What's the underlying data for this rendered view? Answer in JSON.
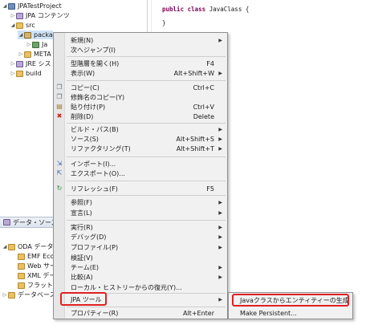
{
  "editor": {
    "line1_keywords": "public class",
    "line1_name": "JavaClass {",
    "line2": "}"
  },
  "tree": {
    "project": "JPATestProject",
    "jpa_content": "JPA コンテンツ",
    "src": "src",
    "package": "packa",
    "java_file": "Ja",
    "meta": "META",
    "jre": "JRE シス",
    "build": "build"
  },
  "data_source_panel": {
    "tab_label": "データ・ソース・",
    "items": [
      "ODA データ",
      "EMF Eco",
      "Web サー",
      "XML デー",
      "フラット",
      "データベース"
    ]
  },
  "context_menu": {
    "items": [
      {
        "label": "新規(N)",
        "shortcut": "",
        "submenu": true
      },
      {
        "label": "次へジャンプ(I)",
        "shortcut": "",
        "submenu": false
      },
      {
        "label": "型階層を開く(H)",
        "shortcut": "F4",
        "submenu": false
      },
      {
        "label": "表示(W)",
        "shortcut": "Alt+Shift+W",
        "submenu": true
      },
      {
        "label": "コピー(C)",
        "shortcut": "Ctrl+C",
        "submenu": false
      },
      {
        "label": "修飾名のコピー(Y)",
        "shortcut": "",
        "submenu": false
      },
      {
        "label": "貼り付け(P)",
        "shortcut": "Ctrl+V",
        "submenu": false
      },
      {
        "label": "削除(D)",
        "shortcut": "Delete",
        "submenu": false
      },
      {
        "label": "ビルド・パス(B)",
        "shortcut": "",
        "submenu": true
      },
      {
        "label": "ソース(S)",
        "shortcut": "Alt+Shift+S",
        "submenu": true
      },
      {
        "label": "リファクタリング(T)",
        "shortcut": "Alt+Shift+T",
        "submenu": true
      },
      {
        "label": "インポート(I)...",
        "shortcut": "",
        "submenu": false
      },
      {
        "label": "エクスポート(O)...",
        "shortcut": "",
        "submenu": false
      },
      {
        "label": "リフレッシュ(F)",
        "shortcut": "F5",
        "submenu": false
      },
      {
        "label": "参照(F)",
        "shortcut": "",
        "submenu": true
      },
      {
        "label": "宣言(L)",
        "shortcut": "",
        "submenu": true
      },
      {
        "label": "実行(R)",
        "shortcut": "",
        "submenu": true
      },
      {
        "label": "デバッグ(D)",
        "shortcut": "",
        "submenu": true
      },
      {
        "label": "プロファイル(P)",
        "shortcut": "",
        "submenu": true
      },
      {
        "label": "検証(V)",
        "shortcut": "",
        "submenu": false
      },
      {
        "label": "チーム(E)",
        "shortcut": "",
        "submenu": true
      },
      {
        "label": "比較(A)",
        "shortcut": "",
        "submenu": true
      },
      {
        "label": "ローカル・ヒストリーからの復元(Y)...",
        "shortcut": "",
        "submenu": false
      },
      {
        "label": "JPA ツール",
        "shortcut": "",
        "submenu": true
      },
      {
        "label": "プロパティー(R)",
        "shortcut": "Alt+Enter",
        "submenu": false
      }
    ]
  },
  "submenu": {
    "items": [
      "Javaクラスからエンティティーの生成",
      "Make Persistent..."
    ]
  },
  "colors": {
    "highlight_red": "#e02020",
    "keyword": "#7f0055",
    "selection": "#cfe3f7"
  }
}
